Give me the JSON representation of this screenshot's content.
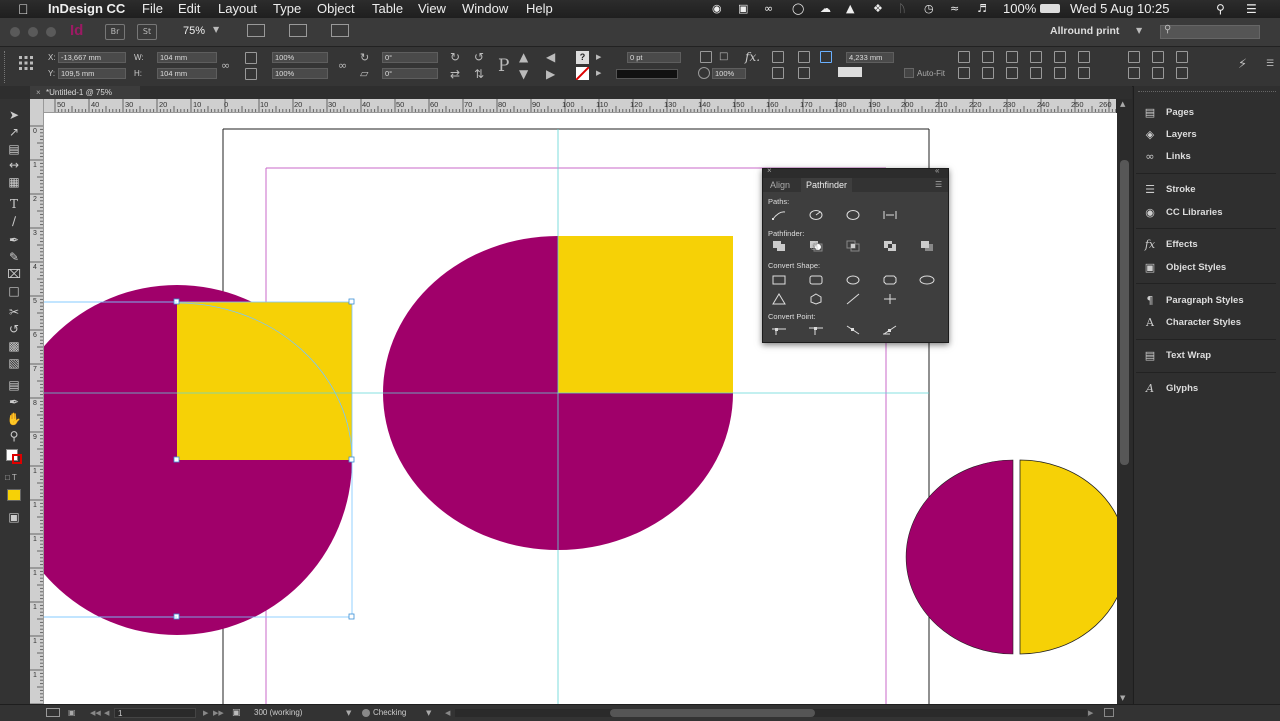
{
  "menubar": {
    "apple": "",
    "app_name": "InDesign CC",
    "items": [
      "File",
      "Edit",
      "Layout",
      "Type",
      "Object",
      "Table",
      "View",
      "Window",
      "Help"
    ],
    "battery": "100%",
    "datetime": "Wed 5 Aug  10:25"
  },
  "appbar": {
    "logo": "Id",
    "bridge_label": "Br",
    "stock_label": "St",
    "zoom": "75%",
    "workspace": "Allround print",
    "search_placeholder": ""
  },
  "control": {
    "x_label": "X:",
    "x_value": "-13,667 mm",
    "y_label": "Y:",
    "y_value": "109,5 mm",
    "w_label": "W:",
    "w_value": "104 mm",
    "h_label": "H:",
    "h_value": "104 mm",
    "scale_x": "100%",
    "scale_y": "100%",
    "rotate": "0°",
    "shear": "0°",
    "stroke_weight": "0 pt",
    "opacity": "100%",
    "offset": "4,233 mm",
    "autofit_label": "Auto-Fit"
  },
  "doc_tab": {
    "title": "*Untitled-1 @ 75%"
  },
  "rulers": {
    "h_ticks": [
      "50",
      "40",
      "30",
      "20",
      "10",
      "0",
      "10",
      "20",
      "30",
      "40",
      "50",
      "60",
      "70",
      "80",
      "90",
      "100",
      "110",
      "120",
      "130",
      "140",
      "150",
      "160",
      "170",
      "180",
      "190",
      "200",
      "210",
      "220",
      "230",
      "240",
      "250",
      "260"
    ],
    "v_ticks": [
      "0",
      "1",
      "2",
      "3",
      "4",
      "5",
      "6",
      "7",
      "8",
      "9",
      "1",
      "1",
      "1",
      "1",
      "1",
      "1",
      "1"
    ]
  },
  "panels": {
    "items": [
      "Pages",
      "Layers",
      "Links",
      "Stroke",
      "CC Libraries",
      "Effects",
      "Object Styles",
      "Paragraph Styles",
      "Character Styles",
      "Text Wrap",
      "Glyphs"
    ]
  },
  "pathfinder": {
    "tab_align": "Align",
    "tab_pathfinder": "Pathfinder",
    "sec_paths": "Paths:",
    "sec_pathfinder": "Pathfinder:",
    "sec_convert_shape": "Convert Shape:",
    "sec_convert_point": "Convert Point:"
  },
  "status": {
    "page": "1",
    "profile": "300 (working)",
    "preflight": "Checking"
  },
  "colors": {
    "magenta": "#a0006a",
    "yellow": "#f6d106",
    "ui_dark": "#2f2f2f"
  }
}
